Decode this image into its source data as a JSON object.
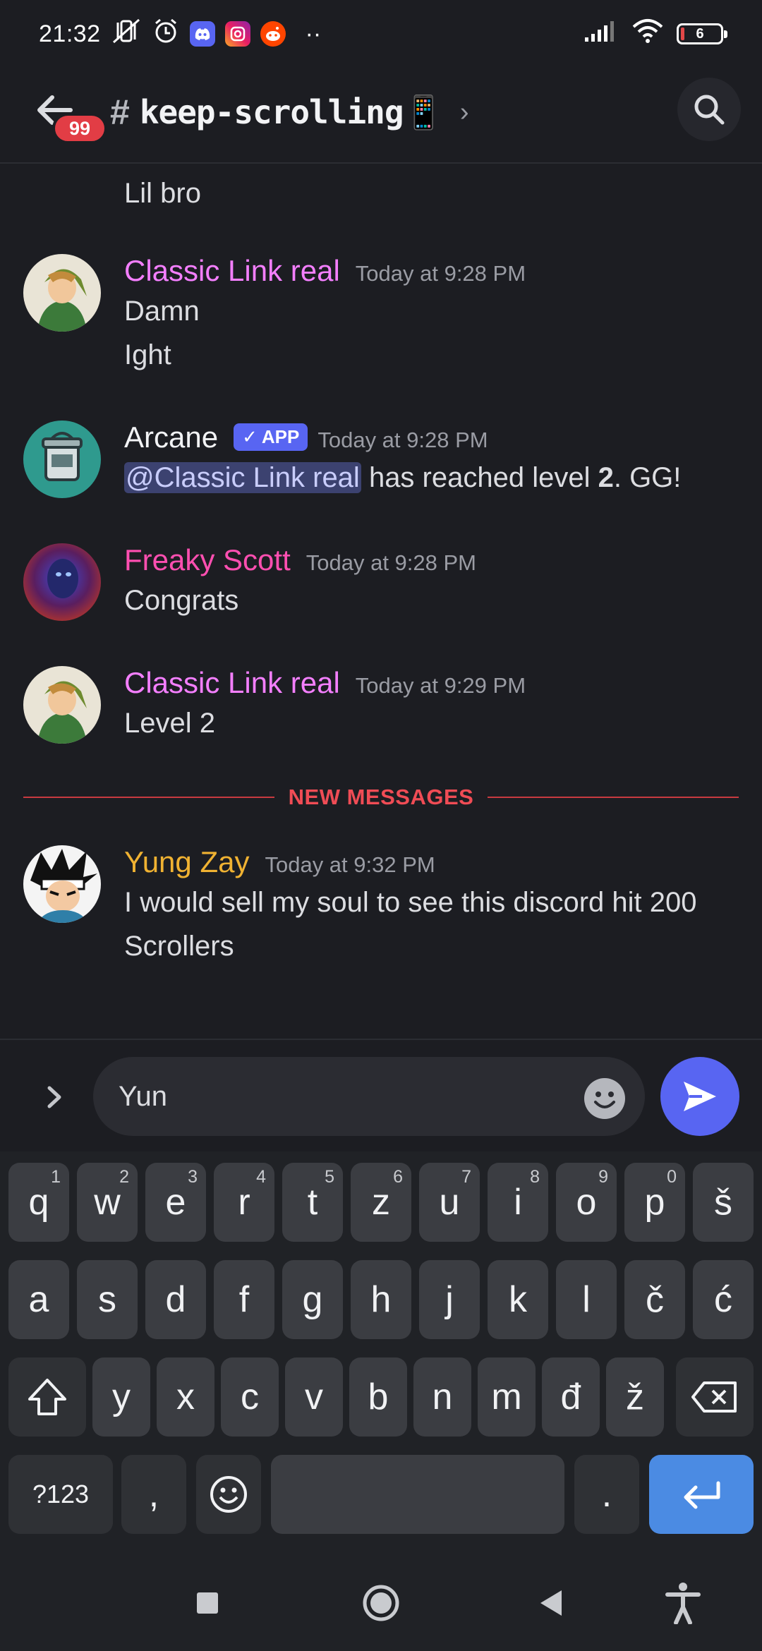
{
  "status_bar": {
    "time": "21:32",
    "battery_level": "6",
    "icons": [
      "mute-vibrate-icon",
      "alarm-icon",
      "discord-icon",
      "instagram-icon",
      "reddit-icon",
      "more-dots-icon",
      "signal-icon",
      "wifi-icon",
      "battery-icon"
    ],
    "overflow_dots": "··"
  },
  "header": {
    "unread_badge": "99",
    "channel_prefix": "#",
    "channel_name": "keep-scrolling📱",
    "chevron": "›"
  },
  "messages": {
    "continuation": "Lil bro",
    "items": [
      {
        "author": "Classic Link real",
        "author_color": "#f47fff",
        "timestamp": "Today at 9:28 PM",
        "lines": [
          "Damn",
          "Ight"
        ]
      },
      {
        "author": "Arcane",
        "author_color": "#f2f3f5",
        "app_tag": "APP",
        "timestamp": "Today at 9:28 PM",
        "mention": "@Classic Link real",
        "text_before_bold": " has reached level ",
        "bold": "2",
        "text_after_bold": ". GG!"
      },
      {
        "author": "Freaky Scott",
        "author_color": "#ff4fb1",
        "timestamp": "Today at 9:28 PM",
        "lines": [
          "Congrats"
        ]
      },
      {
        "author": "Classic Link real",
        "author_color": "#f47fff",
        "timestamp": "Today at 9:29 PM",
        "lines": [
          "Level 2"
        ]
      },
      {
        "author": "Yung Zay",
        "author_color": "#f0b232",
        "timestamp": "Today at 9:32 PM",
        "lines": [
          "I would sell my soul to see this discord hit 200",
          "Scrollers"
        ]
      }
    ],
    "new_divider": "NEW MESSAGES"
  },
  "composer": {
    "value": "Yun"
  },
  "keyboard": {
    "row1": [
      {
        "k": "q",
        "h": "1"
      },
      {
        "k": "w",
        "h": "2"
      },
      {
        "k": "e",
        "h": "3"
      },
      {
        "k": "r",
        "h": "4"
      },
      {
        "k": "t",
        "h": "5"
      },
      {
        "k": "z",
        "h": "6"
      },
      {
        "k": "u",
        "h": "7"
      },
      {
        "k": "i",
        "h": "8"
      },
      {
        "k": "o",
        "h": "9"
      },
      {
        "k": "p",
        "h": "0"
      },
      {
        "k": "š",
        "h": ""
      }
    ],
    "row2": [
      "a",
      "s",
      "d",
      "f",
      "g",
      "h",
      "j",
      "k",
      "l",
      "č",
      "ć"
    ],
    "row3": [
      "y",
      "x",
      "c",
      "v",
      "b",
      "n",
      "m",
      "đ",
      "ž"
    ],
    "symbols_label": "?123",
    "comma": ",",
    "period": "."
  },
  "colors": {
    "background": "#1c1d22",
    "accent": "#5865f2",
    "new_messages": "#f04c55",
    "badge": "#e23d45"
  }
}
